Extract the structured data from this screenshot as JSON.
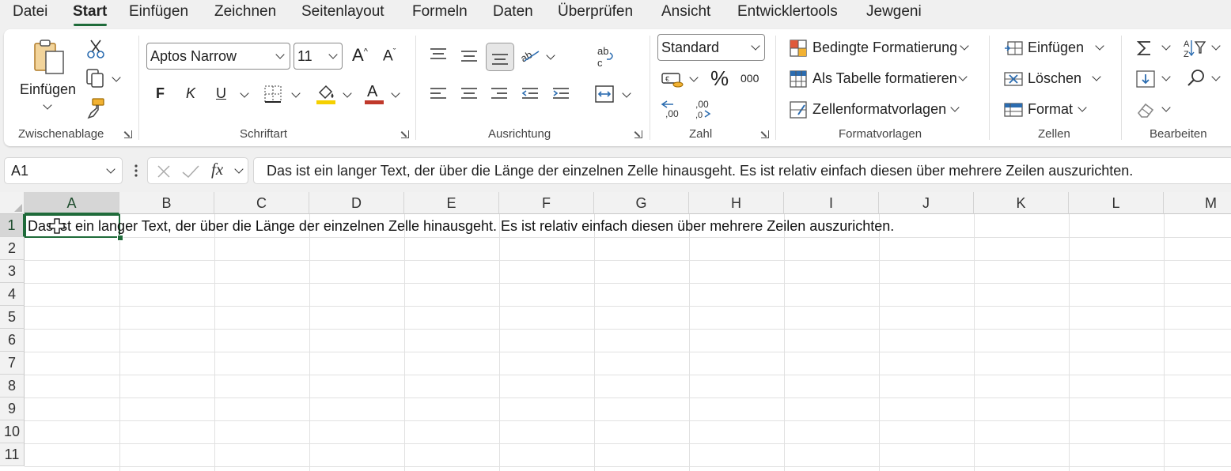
{
  "menu": {
    "tabs": [
      "Datei",
      "Start",
      "Einfügen",
      "Zeichnen",
      "Seitenlayout",
      "Formeln",
      "Daten",
      "Überprüfen",
      "Ansicht",
      "Entwicklertools",
      "Jewgeni"
    ],
    "active": "Start"
  },
  "ribbon": {
    "clipboard": {
      "paste_label": "Einfügen",
      "group_label": "Zwischenablage"
    },
    "font": {
      "font_name": "Aptos Narrow",
      "font_size": "11",
      "bold": "F",
      "italic": "K",
      "underline": "U",
      "group_label": "Schriftart"
    },
    "alignment": {
      "group_label": "Ausrichtung"
    },
    "number": {
      "format": "Standard",
      "percent": "%",
      "thousands": "000",
      "group_label": "Zahl"
    },
    "styles": {
      "conditional_formatting": "Bedingte Formatierung",
      "format_as_table": "Als Tabelle formatieren",
      "cell_styles": "Zellenformatvorlagen",
      "group_label": "Formatvorlagen"
    },
    "cells": {
      "insert": "Einfügen",
      "delete": "Löschen",
      "format": "Format",
      "group_label": "Zellen"
    },
    "editing": {
      "group_label": "Bearbeiten"
    }
  },
  "formula_bar": {
    "name_box": "A1",
    "fx": "fx",
    "content": "Das ist ein langer Text, der über die Länge der einzelnen Zelle hinausgeht. Es ist relativ einfach diesen über mehrere Zeilen auszurichten."
  },
  "sheet": {
    "columns": [
      "A",
      "B",
      "C",
      "D",
      "E",
      "F",
      "G",
      "H",
      "I",
      "J",
      "K",
      "L",
      "M"
    ],
    "rows": [
      "1",
      "2",
      "3",
      "4",
      "5",
      "6",
      "7",
      "8",
      "9",
      "10",
      "11"
    ],
    "selected_cell": "A1",
    "cell_a1": "Das ist ein langer Text, der über die Länge der einzelnen Zelle hinausgeht. Es ist relativ einfach diesen über mehrere Zeilen auszurichten."
  },
  "colors": {
    "accent": "#1f6b3a",
    "font_color_bar": "#c0392b",
    "fill_color_bar": "#f5d000"
  }
}
